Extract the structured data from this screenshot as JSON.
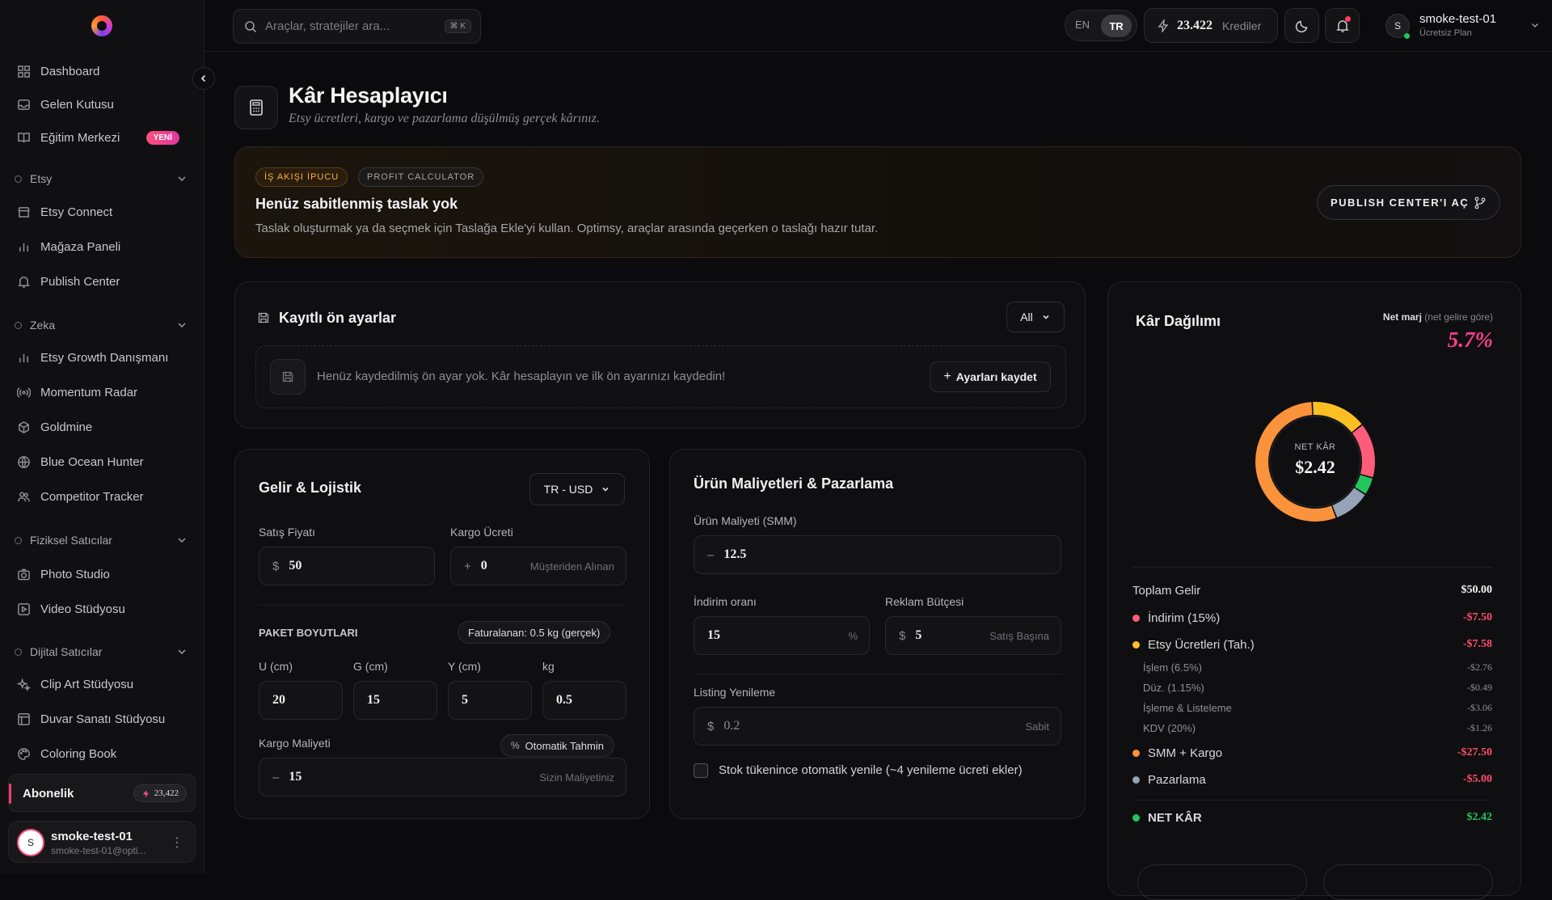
{
  "sidebar": {
    "items": [
      {
        "label": "Dashboard"
      },
      {
        "label": "Gelen Kutusu"
      },
      {
        "label": "Eğitim Merkezi",
        "badge": "YENİ"
      }
    ],
    "sections": [
      {
        "label": "Etsy",
        "items": [
          "Etsy Connect",
          "Mağaza Paneli",
          "Publish Center"
        ]
      },
      {
        "label": "Zeka",
        "items": [
          "Etsy Growth Danışmanı",
          "Momentum Radar",
          "Goldmine",
          "Blue Ocean Hunter",
          "Competitor Tracker"
        ]
      },
      {
        "label": "Fiziksel Satıcılar",
        "items": [
          "Photo Studio",
          "Video Stüdyosu"
        ]
      },
      {
        "label": "Dijital Satıcılar",
        "items": [
          "Clip Art Stüdyosu",
          "Duvar Sanatı Stüdyosu",
          "Coloring Book"
        ]
      }
    ],
    "subscription": {
      "label": "Abonelik",
      "credits": "23,422"
    },
    "user": {
      "avatar": "S",
      "name": "smoke-test-01",
      "email": "smoke-test-01@opti..."
    }
  },
  "topbar": {
    "search_placeholder": "Araçlar, stratejiler ara...",
    "shortcut": "⌘ K",
    "lang_en": "EN",
    "lang_tr": "TR",
    "credits_value": "23.422",
    "credits_label": "Krediler",
    "user_avatar": "S",
    "user_name": "smoke-test-01",
    "user_plan": "Ücretsiz Plan"
  },
  "page": {
    "title": "Kâr Hesaplayıcı",
    "subtitle": "Etsy ücretleri, kargo ve pazarlama düşülmüş gerçek kârınız."
  },
  "tip": {
    "tag1": "İŞ AKIŞI İPUCU",
    "tag2": "PROFIT CALCULATOR",
    "title": "Henüz sabitlenmiş taslak yok",
    "text": "Taslak oluşturmak ya da seçmek için Taslağa Ekle'yi kullan. Optimsy, araçlar arasında geçerken o taslağı hazır tutar.",
    "button": "PUBLISH CENTER'I AÇ"
  },
  "presets": {
    "title": "Kayıtlı ön ayarlar",
    "filter": "All",
    "empty_text": "Henüz kaydedilmiş ön ayar yok. Kâr hesaplayın ve ilk ön ayarınızı kaydedin!",
    "save_button": "Ayarları kaydet"
  },
  "revenue": {
    "title": "Gelir & Lojistik",
    "region": "TR - USD",
    "sale_price_label": "Satış Fiyatı",
    "sale_price_prefix": "$",
    "sale_price": "50",
    "shipping_label": "Kargo Ücreti",
    "shipping_prefix": "+",
    "shipping": "0",
    "shipping_suffix": "Müşteriden Alınan",
    "package_label": "PAKET BOYUTLARI",
    "billed": "Faturalanan: 0.5 kg (gerçek)",
    "dims": [
      {
        "label": "U (cm)",
        "value": "20"
      },
      {
        "label": "G (cm)",
        "value": "15"
      },
      {
        "label": "Y (cm)",
        "value": "5"
      },
      {
        "label": "kg",
        "value": "0.5"
      }
    ],
    "cost_label": "Kargo Maliyeti",
    "auto_button": "Otomatik Tahmin",
    "cost_prefix": "–",
    "cost": "15",
    "cost_suffix": "Sizin Maliyetiniz"
  },
  "product": {
    "title": "Ürün Maliyetleri & Pazarlama",
    "cogs_label": "Ürün Maliyeti (SMM)",
    "cogs_prefix": "–",
    "cogs": "12.5",
    "discount_label": "İndirim oranı",
    "discount": "15",
    "discount_suffix": "%",
    "ad_label": "Reklam Bütçesi",
    "ad_prefix": "$",
    "ad": "5",
    "ad_suffix": "Satış Başına",
    "renew_label": "Listing Yenileme",
    "renew_prefix": "$",
    "renew": "0.2",
    "renew_suffix": "Sabit",
    "checkbox_label": "Stok tükenince otomatik yenile (~4 yenileme ücreti ekler)"
  },
  "breakdown": {
    "title": "Kâr Dağılımı",
    "margin_label": "Net marj",
    "margin_note": "(net gelire göre)",
    "margin": "5.7%",
    "center_label": "NET KÂR",
    "center_value": "$2.42",
    "total_label": "Toplam Gelir",
    "total_value": "$50.00",
    "rows": [
      {
        "label": "İndirim (15%)",
        "value": "-$7.50",
        "color": "#ff5c7a"
      },
      {
        "label": "Etsy Ücretleri (Tah.)",
        "value": "-$7.58",
        "color": "#fbbf24"
      }
    ],
    "sub_rows": [
      {
        "label": "İşlem (6.5%)",
        "value": "-$2.76"
      },
      {
        "label": "Düz. (1.15%)",
        "value": "-$0.49"
      },
      {
        "label": "İşleme & Listeleme",
        "value": "-$3.06"
      },
      {
        "label": "KDV (20%)",
        "value": "-$1.26"
      }
    ],
    "rows2": [
      {
        "label": "SMM + Kargo",
        "value": "-$27.50",
        "color": "#fb923c"
      },
      {
        "label": "Pazarlama",
        "value": "-$5.00",
        "color": "#94a3b8"
      }
    ],
    "net_label": "NET KÂR",
    "net_value": "$2.42",
    "net_color": "#22c55e"
  },
  "chart_data": {
    "type": "pie",
    "categories": [
      "İndirim",
      "Etsy Ücretleri",
      "SMM + Kargo",
      "Pazarlama",
      "NET KÂR"
    ],
    "values": [
      7.5,
      7.58,
      27.5,
      5.0,
      2.42
    ],
    "colors": [
      "#ff5c7a",
      "#fbbf24",
      "#fb923c",
      "#94a3b8",
      "#22c55e"
    ]
  }
}
